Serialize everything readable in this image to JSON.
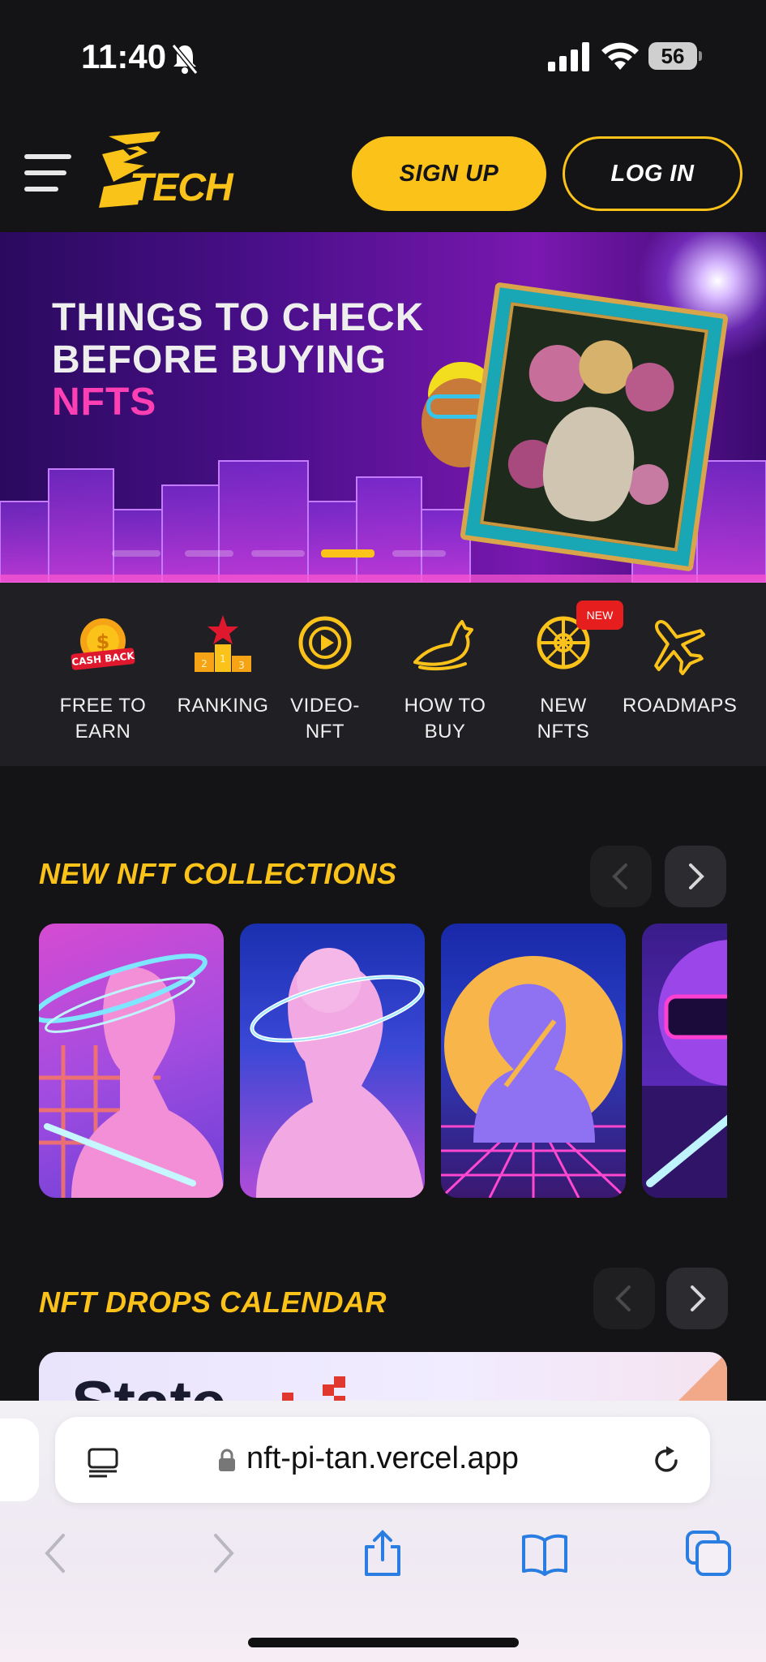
{
  "status_bar": {
    "time": "11:40",
    "battery": "56",
    "icons": [
      "bell-muted-icon",
      "signal-icon",
      "wifi-icon",
      "battery-icon"
    ]
  },
  "header": {
    "logo_text": "TECH",
    "signup_label": "SIGN UP",
    "login_label": "LOG IN",
    "accent_color": "#fbc21a"
  },
  "banner": {
    "line1": "THINGS TO CHECK",
    "line2": "BEFORE BUYING",
    "line3": "NFTS",
    "slide_count": 5,
    "active_slide": 3
  },
  "categories": [
    {
      "label": "FREE TO EARN",
      "icon": "cashback-icon",
      "line1": "FREE TO",
      "line2": "EARN"
    },
    {
      "label": "RANKING",
      "icon": "podium-icon",
      "line1": "RANKING",
      "line2": ""
    },
    {
      "label": "VIDEO-NFT",
      "icon": "play-circle-icon",
      "line1": "VIDEO-",
      "line2": "NFT"
    },
    {
      "label": "HOW TO BUY",
      "icon": "horse-icon",
      "line1": "HOW TO",
      "line2": "BUY"
    },
    {
      "label": "NEW NFTS",
      "icon": "wheel-icon",
      "line1": "NEW",
      "line2": "NFTS",
      "badge": "NEW"
    },
    {
      "label": "ROADMAPS",
      "icon": "airplane-icon",
      "line1": "ROADMAPS",
      "line2": ""
    }
  ],
  "collections": {
    "title": "NEW NFT COLLECTIONS"
  },
  "drops": {
    "title": "NFT DROPS CALENDAR",
    "banner_text": "State"
  },
  "browser": {
    "url": "nft-pi-tan.vercel.app"
  }
}
